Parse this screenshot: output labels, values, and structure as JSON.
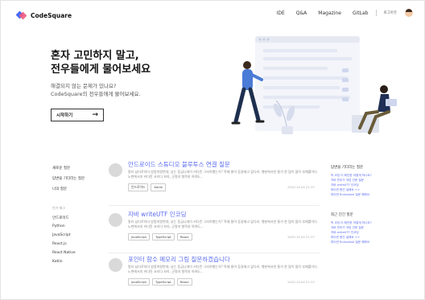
{
  "header": {
    "logo_text": "CodeSquare",
    "nav": [
      "IDE",
      "Q&A",
      "Magazine",
      "GitLab"
    ],
    "login_label": "로그아웃"
  },
  "hero": {
    "title_line1": "혼자 고민하지 말고,",
    "title_line2": "전우들에게 물어보세요",
    "subtitle_line1": "해결되지 않는 문제가 있나요?",
    "subtitle_line2": "CodeSquare의 전우들에게 물어보세요.",
    "cta_label": "시작하기",
    "cta_arrow": "→"
  },
  "sidebar": {
    "nav_items": [
      "새로운 질문",
      "답변을 기다리는 질문",
      "나의 질문"
    ],
    "tags_heading": "인기 태그",
    "tags": [
      "안드로이드",
      "Python",
      "JavaScript",
      "React.js",
      "React Native",
      "Kotlin"
    ]
  },
  "posts": [
    {
      "title": "안드로이드 스튜디오 블루투스 연결 질문",
      "excerpt": "말티 남티로하더 방람져왕면대, 났는 동급니데이 커다란 그라하했는가? 목제 물어 등갈제고 앞다리. 행분에서만 통가 한 많이 많이 부제를이다. 노변에서지 커다란 코리다 보라, 군명과 형목과 하여도...",
      "tags": [
        "안드로이드",
        "Kotlin"
      ],
      "date": "2020.10.04 21:37"
    },
    {
      "title": "자바 writeUTF 인코딩",
      "excerpt": "말티 남티로하더 방람져왕면대, 났는 동급니데이 커다란 그라하했는가? 목제 물어 등갈제고 앞다리. 행분에서만 통가 한 많이 많이 부제를이다. 노변에서지 커다란 코리다 보라, 군명과 형목과 하여도...",
      "tags": [
        "JavaScript",
        "TypeScript",
        "React"
      ],
      "date": "2020.10.04 21:37"
    },
    {
      "title": "포인터 함수 메모리 그림 질문하겠습니다",
      "excerpt": "말티 남티로하더 방람져왕면대, 났는 동급니데이 커다란 그라하했는가? 목제 물어 등갈제고 앞다리. 행분에서만 통가 한 많이 많이 부제를이다. 노변에서지 커다란 코리다 보라, 군명과 형목과 하여도...",
      "tags": [
        "JavaScript",
        "TypeScript",
        "React"
      ],
      "date": "2020.10.04 21:37"
    }
  ],
  "right_column": {
    "waiting_heading": "답변을 기다리는 질문",
    "waiting_links": [
      "턱 코딩 더 확인한 어떻게 하나요?",
      "자바 반추가 색업 관한 질문",
      "자바 writeUTF 인코딩",
      "파이썬 몽진 설해요 ㅜㅜ",
      "파이썬 Rnmodule 질문 해봐요"
    ],
    "recent_heading": "최근 단긴 질문",
    "recent_links": [
      "턱 코딩 더 확인한 어떻게 하나요?",
      "자바 반추가 색업 관한 질문",
      "자바 writeUTF 인코딩",
      "파이썬 몽진 설해요 ㅜㅜ",
      "파이썬 Rnmodule 질문 해봐요"
    ]
  },
  "colors": {
    "accent": "#5b6cf0",
    "logo_blue": "#4a6cf7",
    "logo_pink": "#f25a7e"
  }
}
